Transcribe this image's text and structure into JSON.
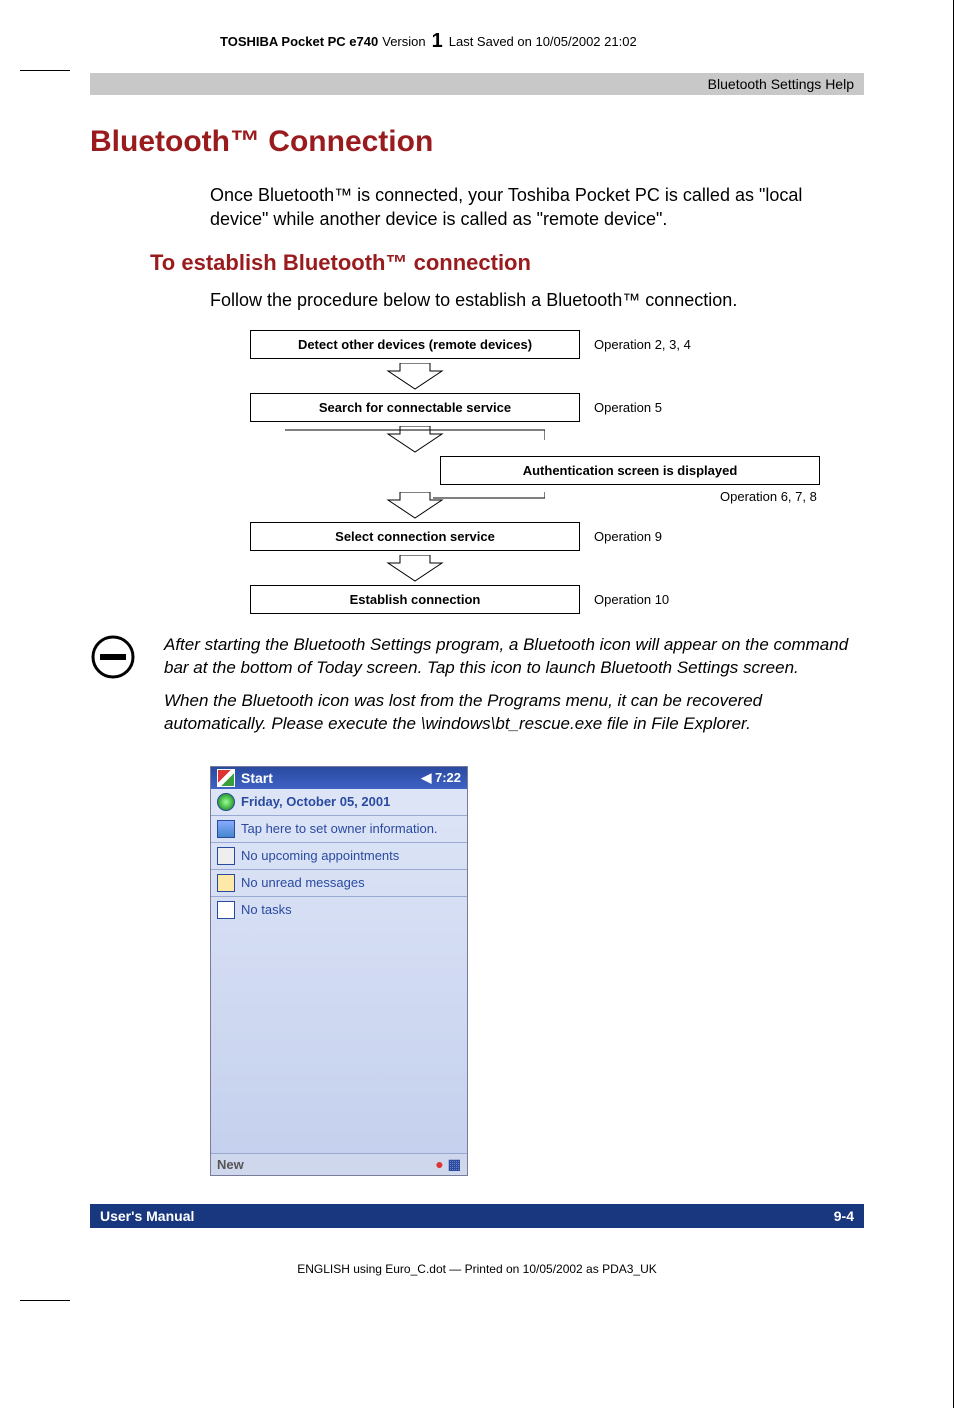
{
  "header": {
    "product": "TOSHIBA Pocket PC e740",
    "version_label": "Version",
    "version_num": "1",
    "saved": "Last Saved on 10/05/2002 21:02"
  },
  "greybar": "Bluetooth Settings Help",
  "h1": "Bluetooth™ Connection",
  "intro": "Once Bluetooth™ is connected, your Toshiba Pocket PC is called as \"local device\" while another device is called as \"remote device\".",
  "h2": "To establish Bluetooth™ connection",
  "lead": "Follow the procedure below to establish a Bluetooth™ connection.",
  "flow": {
    "step1": {
      "box": "Detect other devices (remote devices)",
      "label": "Operation 2, 3, 4"
    },
    "step2": {
      "box": "Search for connectable service",
      "label": "Operation 5"
    },
    "branch": {
      "box": "Authentication screen is displayed",
      "label": "Operation 6, 7, 8"
    },
    "step3": {
      "box": "Select connection service",
      "label": "Operation 9"
    },
    "step4": {
      "box": "Establish connection",
      "label": "Operation 10"
    }
  },
  "note": {
    "p1": "After starting the Bluetooth Settings program, a Bluetooth icon will appear on the command bar at the bottom of Today screen. Tap this icon to launch Bluetooth Settings screen.",
    "p2": "When the Bluetooth icon was lost from the Programs menu, it can be recovered automatically. Please execute the  \\windows\\bt_rescue.exe file in File Explorer."
  },
  "pda": {
    "title": "Start",
    "time": "7:22",
    "date": "Friday, October 05, 2001",
    "owner": "Tap here to set owner information.",
    "appts": "No upcoming appointments",
    "msgs": "No unread messages",
    "tasks": "No tasks",
    "bottom_left": "New"
  },
  "footer": {
    "left": "User's Manual",
    "right": "9-4"
  },
  "print_meta": "ENGLISH using  Euro_C.dot — Printed on 10/05/2002 as PDA3_UK"
}
